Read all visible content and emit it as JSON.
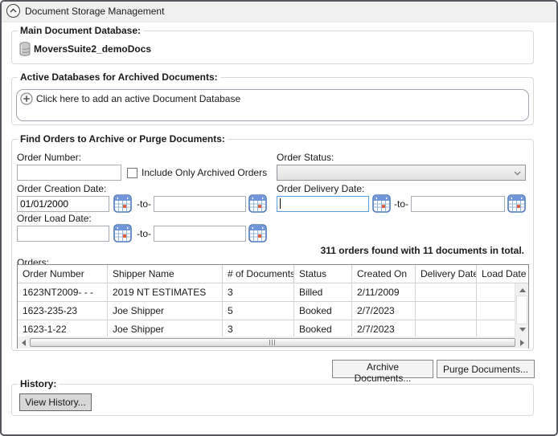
{
  "window": {
    "title": "Document Storage Management"
  },
  "main_db": {
    "label": "Main Document Database:",
    "value": "MoversSuite2_demoDocs"
  },
  "active_db": {
    "label": "Active Databases for Archived Documents:",
    "add_prompt": "Click here to add an active Document Database"
  },
  "find": {
    "label": "Find Orders to Archive or Purge Documents:",
    "order_number_label": "Order Number:",
    "order_number_value": "",
    "include_archived_label": "Include Only Archived Orders",
    "include_archived_checked": false,
    "order_status_label": "Order Status:",
    "order_status_value": "",
    "creation_date_label": "Order Creation Date:",
    "creation_from": "01/01/2000",
    "creation_to": "",
    "delivery_date_label": "Order Delivery Date:",
    "delivery_from": "",
    "delivery_to": "",
    "load_date_label": "Order Load Date:",
    "load_from": "",
    "load_to": "",
    "to_separator": "-to-",
    "results_summary": "311 orders found with 11 documents in total.",
    "orders_label": "Orders:"
  },
  "orders_table": {
    "columns": [
      "Order Number",
      "Shipper Name",
      "# of Documents",
      "Status",
      "Created On",
      "Delivery Date",
      "Load Date"
    ],
    "rows": [
      [
        "1623NT2009- - -",
        "2019 NT ESTIMATES",
        "3",
        "Billed",
        "2/11/2009",
        "",
        ""
      ],
      [
        "1623-235-23",
        "Joe Shipper",
        "5",
        "Booked",
        "2/7/2023",
        "",
        ""
      ],
      [
        "1623-1-22",
        "Joe Shipper",
        "3",
        "Booked",
        "2/7/2023",
        "",
        ""
      ]
    ]
  },
  "actions": {
    "archive_label": "Archive Documents...",
    "purge_label": "Purge Documents..."
  },
  "history": {
    "label": "History:",
    "view_button_label": "View History..."
  },
  "colors": {
    "focus_border": "#569de5",
    "calendar_blue": "#4a76b9",
    "calendar_red": "#e0603c",
    "header_bg": "#f0f0f0",
    "group_border": "#d9d9d9"
  }
}
